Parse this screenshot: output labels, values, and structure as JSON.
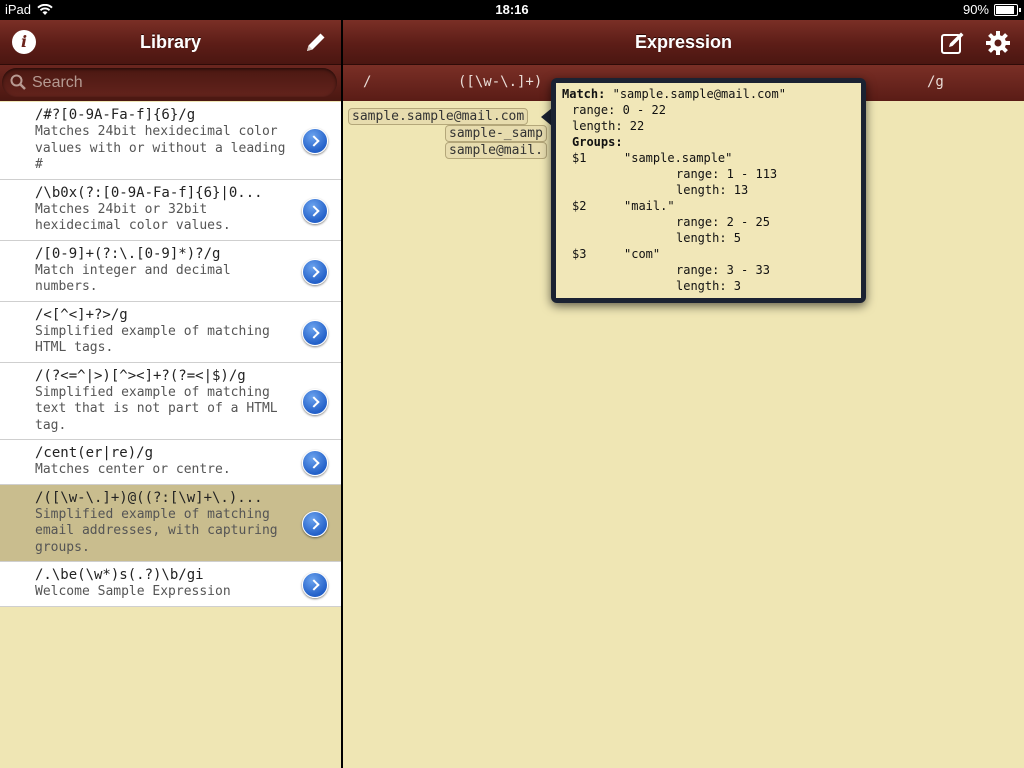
{
  "status_bar": {
    "device": "iPad",
    "time": "18:16",
    "battery": "90%",
    "battery_level": 0.9
  },
  "library": {
    "title": "Library",
    "search_placeholder": "Search",
    "items": [
      {
        "title": "/#?[0-9A-Fa-f]{6}/g",
        "description": "Matches 24bit hexidecimal color values with or without a leading #"
      },
      {
        "title": "/\\b0x(?:[0-9A-Fa-f]{6}|0...",
        "description": "Matches 24bit or 32bit hexidecimal color values."
      },
      {
        "title": "/[0-9]+(?:\\.[0-9]*)?/g",
        "description": "Match integer and decimal numbers."
      },
      {
        "title": "/<[^<]+?>/g",
        "description": "Simplified example of matching HTML tags."
      },
      {
        "title": "/(?<=^|>)[^><]+?(?=<|$)/g",
        "description": "Simplified example of matching text that is not part of a HTML tag."
      },
      {
        "title": "/cent(er|re)/g",
        "description": "Matches center or centre."
      },
      {
        "title": "/([\\w-\\.]+)@((?:[\\w]+\\.)...",
        "description": "Simplified example of matching email addresses, with capturing groups.",
        "selected": true
      },
      {
        "title": "/.\\be(\\w*)s(.?)\\b/gi",
        "description": "Welcome Sample Expression"
      }
    ]
  },
  "expression": {
    "title": "Expression",
    "regex_open": "/",
    "regex_pattern": "([\\w-\\.]+)",
    "regex_close": "/g",
    "matches": [
      "sample.sample@mail.com",
      "sample-_samp",
      "sample@mail."
    ]
  },
  "popover": {
    "match_label": "Match:",
    "match_value": "\"sample.sample@mail.com\"",
    "range": "range: 0 - 22",
    "length": "length: 22",
    "groups_label": "Groups:",
    "groups": [
      {
        "id": "$1",
        "value": "\"sample.sample\"",
        "range": "range: 1 - 113",
        "length": "length: 13"
      },
      {
        "id": "$2",
        "value": "\"mail.\"",
        "range": "range: 2 - 25",
        "length": "length: 5"
      },
      {
        "id": "$3",
        "value": "\"com\"",
        "range": "range: 3 - 33",
        "length": "length: 3"
      }
    ]
  }
}
